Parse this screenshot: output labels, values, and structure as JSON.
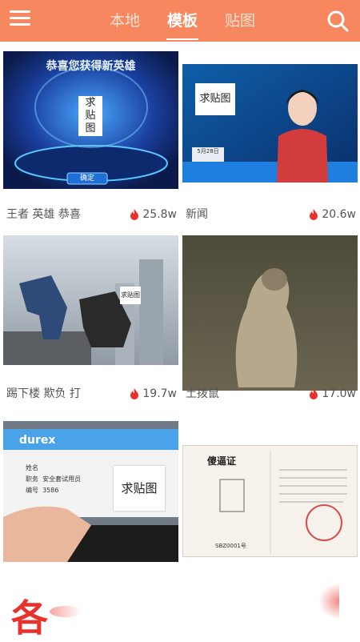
{
  "header": {
    "tabs": [
      {
        "label": "本地",
        "active": false
      },
      {
        "label": "模板",
        "active": true
      },
      {
        "label": "贴图",
        "active": false
      }
    ],
    "menu_icon": "menu-icon",
    "search_icon": "search-icon",
    "accent": "#f7875f"
  },
  "cards": [
    {
      "title": "王者 英雄 恭喜",
      "hot": "25.8w",
      "banner_text": "恭喜您获得新英雄",
      "sticker": "求\n贴\n图",
      "button": "确定"
    },
    {
      "title": "新闻",
      "hot": "20.6w",
      "sticker": "求贴图",
      "caption": "5月28日"
    },
    {
      "title": "踢下楼 欺负 打",
      "hot": "19.7w",
      "sticker": "求贴图"
    },
    {
      "title": "土拨鼠",
      "hot": "17.0w"
    },
    {
      "brand": "durex",
      "card_rows": [
        {
          "k": "姓名",
          "v": ""
        },
        {
          "k": "职务",
          "v": "安全套试用员"
        },
        {
          "k": "编号",
          "v": "3586"
        }
      ],
      "sticker": "求贴图"
    },
    {
      "cert_title": "傻逼证",
      "cert_number": "SBZ0001号"
    }
  ],
  "bottom": {
    "char": "各"
  }
}
